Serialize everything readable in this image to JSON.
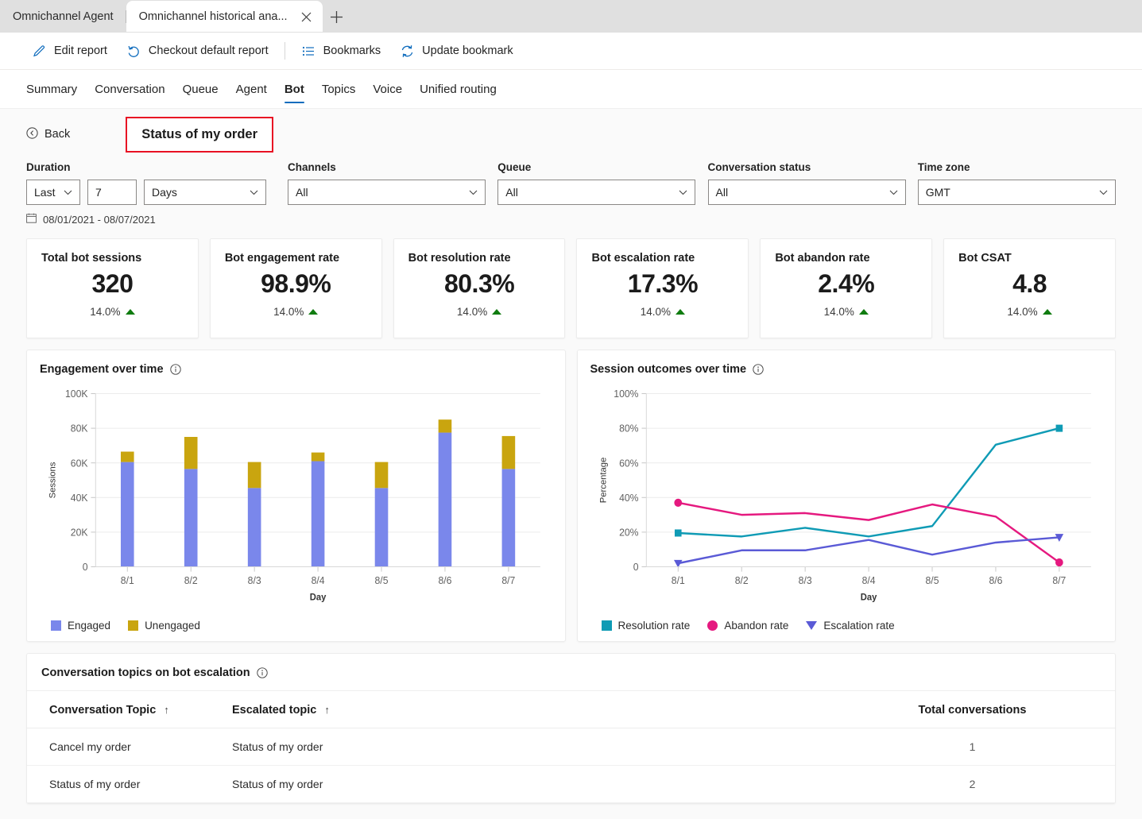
{
  "browser": {
    "tabs": [
      {
        "title": "Omnichannel Agent",
        "active": false
      },
      {
        "title": "Omnichannel historical ana...",
        "active": true
      }
    ],
    "close_icon": "close-icon",
    "new_tab_label": "+"
  },
  "commandbar": {
    "items": [
      {
        "label": "Edit report",
        "icon": "pencil-icon"
      },
      {
        "label": "Checkout default report",
        "icon": "undo-icon"
      },
      {
        "label": "Bookmarks",
        "icon": "list-icon"
      },
      {
        "label": "Update bookmark",
        "icon": "refresh-icon"
      }
    ]
  },
  "navtabs": {
    "items": [
      "Summary",
      "Conversation",
      "Queue",
      "Agent",
      "Bot",
      "Topics",
      "Voice",
      "Unified routing"
    ],
    "selected": "Bot",
    "accent": "#0f6cbd"
  },
  "header": {
    "back_label": "Back",
    "back_icon": "back-circle-icon",
    "report_title": "Status of my order",
    "highlight_color": "#e81123"
  },
  "filters": {
    "duration": {
      "label": "Duration",
      "relative": "Last",
      "amount": "7",
      "unit": "Days",
      "date_range": "08/01/2021 - 08/07/2021",
      "calendar_icon": "calendar-icon"
    },
    "channels": {
      "label": "Channels",
      "value": "All"
    },
    "queue": {
      "label": "Queue",
      "value": "All"
    },
    "conversation_status": {
      "label": "Conversation status",
      "value": "All"
    },
    "time_zone": {
      "label": "Time zone",
      "value": "GMT"
    }
  },
  "kpis": [
    {
      "title": "Total bot sessions",
      "value": "320",
      "delta": "14.0%",
      "trend": "up"
    },
    {
      "title": "Bot engagement rate",
      "value": "98.9%",
      "delta": "14.0%",
      "trend": "up"
    },
    {
      "title": "Bot resolution rate",
      "value": "80.3%",
      "delta": "14.0%",
      "trend": "up"
    },
    {
      "title": "Bot escalation rate",
      "value": "17.3%",
      "delta": "14.0%",
      "trend": "up"
    },
    {
      "title": "Bot abandon rate",
      "value": "2.4%",
      "delta": "14.0%",
      "trend": "up"
    },
    {
      "title": "Bot CSAT",
      "value": "4.8",
      "delta": "14.0%",
      "trend": "up"
    }
  ],
  "chart_data": [
    {
      "type": "bar",
      "title": "Engagement over time",
      "stacked": true,
      "xlabel": "Day",
      "ylabel": "Sessions",
      "categories": [
        "8/1",
        "8/2",
        "8/3",
        "8/4",
        "8/5",
        "8/6",
        "8/7"
      ],
      "ytick_labels": [
        "0",
        "20K",
        "40K",
        "60K",
        "80K",
        "100K"
      ],
      "ytick_values": [
        0,
        20000,
        40000,
        60000,
        80000,
        100000
      ],
      "ylim": [
        0,
        100000
      ],
      "grid": true,
      "legend_position": "bottom",
      "series": [
        {
          "name": "Engaged",
          "color": "#7a87eb",
          "values": [
            60500,
            56500,
            45500,
            61000,
            45500,
            77500,
            56500
          ]
        },
        {
          "name": "Unengaged",
          "color": "#c9a50f",
          "values": [
            6000,
            18500,
            15000,
            5000,
            15000,
            7500,
            19000
          ]
        }
      ]
    },
    {
      "type": "line",
      "title": "Session outcomes over time",
      "xlabel": "Day",
      "ylabel": "Percentage",
      "categories": [
        "8/1",
        "8/2",
        "8/3",
        "8/4",
        "8/5",
        "8/6",
        "8/7"
      ],
      "ytick_labels": [
        "0",
        "20%",
        "40%",
        "60%",
        "80%",
        "100%"
      ],
      "ytick_values": [
        0,
        20,
        40,
        60,
        80,
        100
      ],
      "ylim": [
        0,
        100
      ],
      "grid": true,
      "legend_position": "bottom",
      "series": [
        {
          "name": "Resolution rate",
          "color": "#0f9bb5",
          "marker": "square",
          "values": [
            19.5,
            17.5,
            22.5,
            17.5,
            23.5,
            70.5,
            80
          ]
        },
        {
          "name": "Abandon rate",
          "color": "#e5197f",
          "marker": "circle",
          "values": [
            37,
            30,
            31,
            27,
            36,
            29,
            2.5
          ]
        },
        {
          "name": "Escalation rate",
          "color": "#5a5ad6",
          "marker": "triangle",
          "values": [
            2,
            9.5,
            9.5,
            15.5,
            7,
            14,
            17
          ]
        }
      ]
    }
  ],
  "table": {
    "title": "Conversation topics on bot escalation",
    "info_icon": "info-icon",
    "columns": [
      {
        "label": "Conversation Topic",
        "sort": "↑"
      },
      {
        "label": "Escalated topic",
        "sort": "↑"
      },
      {
        "label": "Total conversations",
        "sort": ""
      }
    ],
    "rows": [
      {
        "topic": "Cancel my order",
        "escalated": "Status of my order",
        "total": "1"
      },
      {
        "topic": "Status of my order",
        "escalated": "Status of my order",
        "total": "2"
      }
    ]
  }
}
